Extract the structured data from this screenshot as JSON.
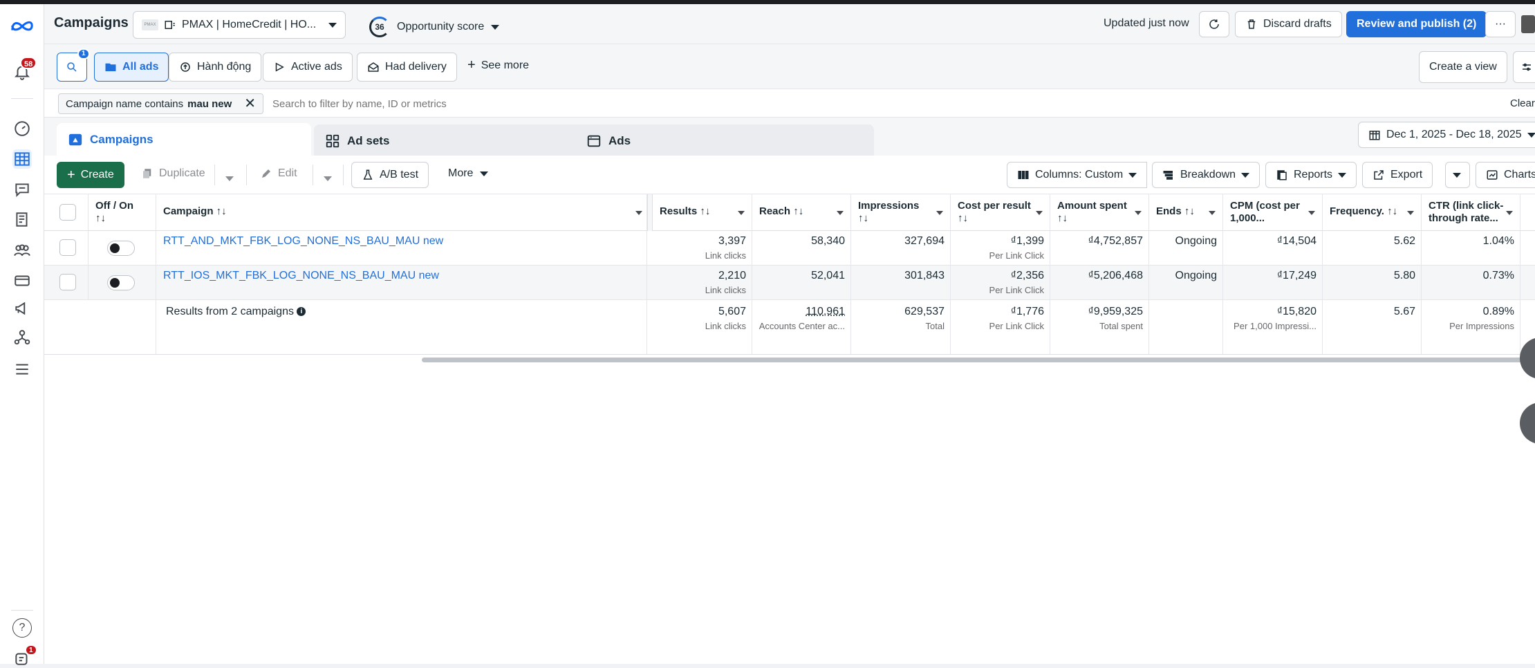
{
  "topbar": {
    "title": "Campaigns",
    "account_name": "PMAX | HomeCredit | HO...",
    "opportunity_score": "36",
    "opportunity_label": "Opportunity score",
    "updated": "Updated just now",
    "discard": "Discard drafts",
    "publish": "Review and publish (2)",
    "more": "···"
  },
  "leftnav": {
    "notif_count": "58",
    "bottom_badge": "1",
    "help": "?"
  },
  "filters": {
    "search_badge": "1",
    "all_ads": "All ads",
    "actions": "Hành động",
    "active_ads": "Active ads",
    "had_delivery": "Had delivery",
    "see_more": "See more",
    "create_view": "Create a view"
  },
  "search": {
    "chip_prefix": "Campaign name contains",
    "chip_value": "mau new",
    "placeholder": "Search to filter by name, ID or metrics",
    "clear": "Clear"
  },
  "tabs": [
    {
      "label": "Campaigns"
    },
    {
      "label": "Ad sets"
    },
    {
      "label": "Ads"
    }
  ],
  "date_range": "Dec 1, 2025 - Dec 18, 2025",
  "toolbar": {
    "create": "Create",
    "duplicate": "Duplicate",
    "edit": "Edit",
    "ab_test": "A/B test",
    "more": "More",
    "columns": "Columns: Custom",
    "breakdown": "Breakdown",
    "reports": "Reports",
    "export": "Export",
    "charts": "Charts"
  },
  "table": {
    "headers": {
      "offon": "Off / On",
      "offon_sort": "↑↓",
      "campaign": "Campaign ↑↓",
      "results": "Results ↑↓",
      "reach": "Reach ↑↓",
      "impressions": "Impressions",
      "impressions_sort": "↑↓",
      "cpr": "Cost per result",
      "cpr_sort": "↑↓",
      "spent": "Amount spent",
      "spent_sort": "↑↓",
      "ends": "Ends ↑↓",
      "cpm": "CPM (cost per",
      "cpm2": "1,000...",
      "freq": "Frequency. ↑↓",
      "ctr": "CTR (link click-",
      "ctr2": "through rate..."
    },
    "rows": [
      {
        "name": "RTT_AND_MKT_FBK_LOG_NONE_NS_BAU_MAU new",
        "results": "3,397",
        "results_sub": "Link clicks",
        "reach": "58,340",
        "impressions": "327,694",
        "cpr": "₫1,399",
        "cpr_sub": "Per Link Click",
        "spent": "₫4,752,857",
        "ends": "Ongoing",
        "cpm": "₫14,504",
        "freq": "5.62",
        "ctr": "1.04%"
      },
      {
        "name": "RTT_IOS_MKT_FBK_LOG_NONE_NS_BAU_MAU new",
        "results": "2,210",
        "results_sub": "Link clicks",
        "reach": "52,041",
        "impressions": "301,843",
        "cpr": "₫2,356",
        "cpr_sub": "Per Link Click",
        "spent": "₫5,206,468",
        "ends": "Ongoing",
        "cpm": "₫17,249",
        "freq": "5.80",
        "ctr": "0.73%"
      }
    ],
    "summary": {
      "label": "Results from 2 campaigns",
      "results": "5,607",
      "results_sub": "Link clicks",
      "reach": "110,961",
      "reach_sub": "Accounts Center ac...",
      "impressions": "629,537",
      "impressions_sub": "Total",
      "cpr": "₫1,776",
      "cpr_sub": "Per Link Click",
      "spent": "₫9,959,325",
      "spent_sub": "Total spent",
      "cpm": "₫15,820",
      "cpm_sub": "Per 1,000 Impressi...",
      "freq": "5.67",
      "ctr": "0.89%",
      "ctr_sub": "Per Impressions"
    }
  },
  "colors": {
    "primary": "#216fdb",
    "create": "#1a6e4a",
    "badge": "#c4161c"
  }
}
